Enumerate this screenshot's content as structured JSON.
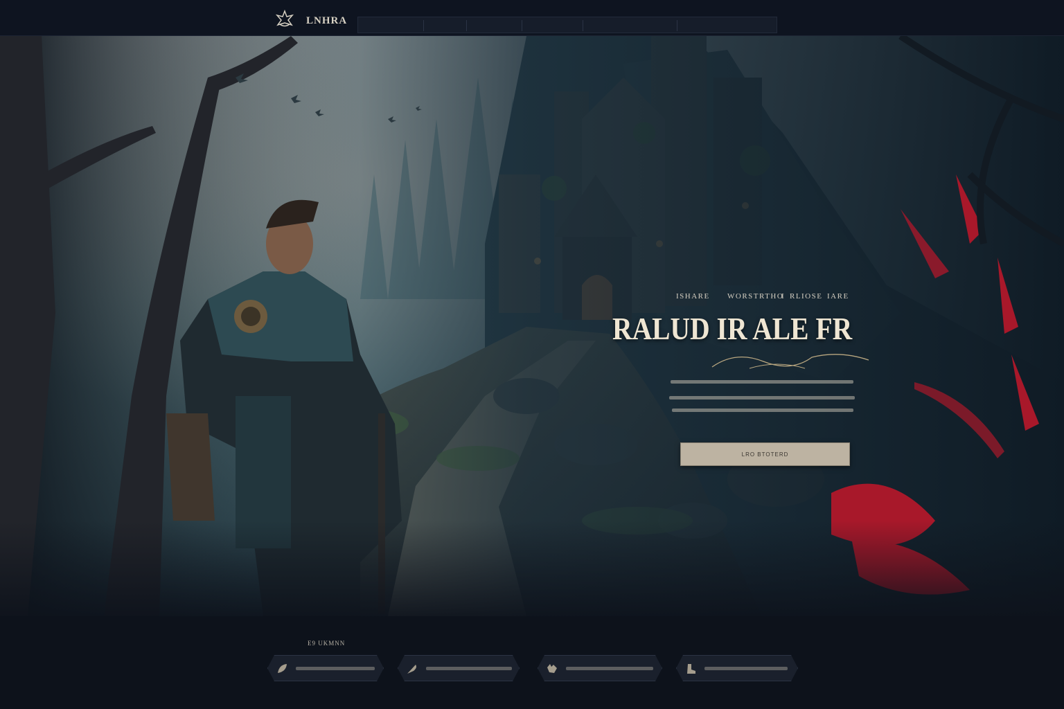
{
  "header": {
    "brand": "LNHRA",
    "nav": [
      "",
      "",
      "",
      "",
      "",
      ""
    ]
  },
  "hero": {
    "tagline": [
      "ISHARE",
      "WORSTRTHO",
      "I",
      "RLIOSE",
      "IARE"
    ],
    "title": "RALUD IR ALE FR",
    "cta_label": "LRO BTOTERD"
  },
  "section": {
    "title": "E9 UKMNN"
  },
  "cards": [
    {
      "icon": "leaf-icon"
    },
    {
      "icon": "feather-icon"
    },
    {
      "icon": "wolf-icon"
    },
    {
      "icon": "boot-icon"
    }
  ],
  "colors": {
    "background": "#0d121b",
    "accent_red": "#a8182a",
    "title": "#efe6d3",
    "button": "#bdb3a2"
  }
}
